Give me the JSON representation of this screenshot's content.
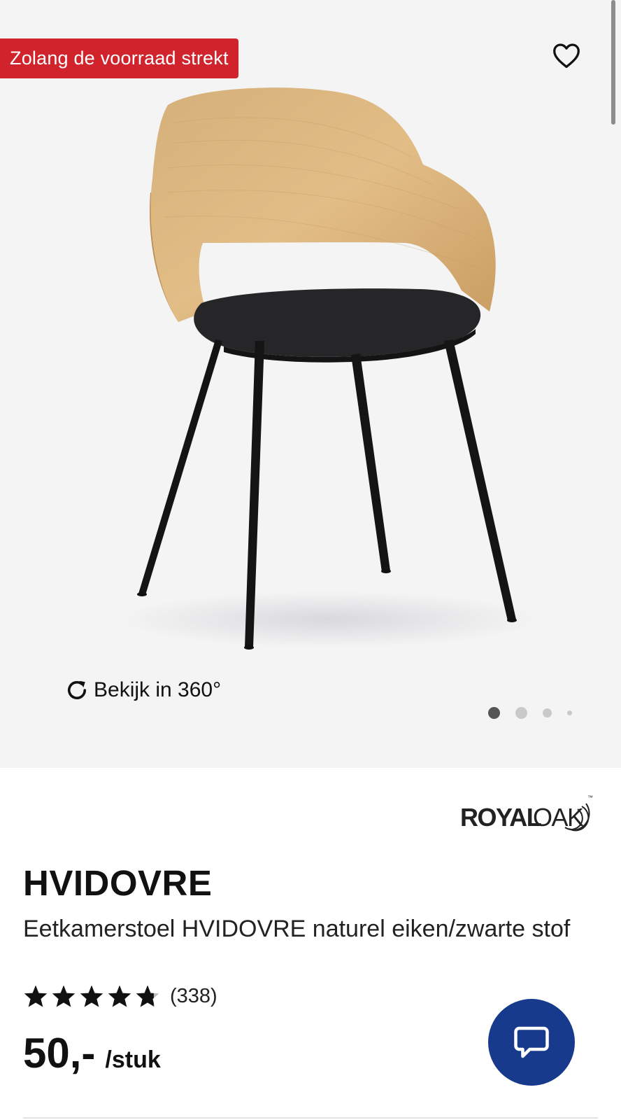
{
  "gallery": {
    "promo_badge": "Zolang de voorraad strekt",
    "view_360_label": "Bekijk in 360°",
    "dots_count": 4,
    "active_dot": 1,
    "favorite_icon": "heart-outline-icon"
  },
  "brand": {
    "logo_text_bold": "ROYAL",
    "logo_text_light": "OAK",
    "logo_tm": "™"
  },
  "product": {
    "title": "HVIDOVRE",
    "subtitle": "Eetkamerstoel HVIDOVRE naturel eiken/zwarte stof",
    "rating_value": 4.8,
    "rating_max": 5,
    "rating_count": "(338)",
    "price": "50,-",
    "price_unit": "/stuk"
  },
  "colors": {
    "promo_red": "#d0232c",
    "chat_blue": "#173a8c",
    "gallery_bg": "#f4f4f5"
  },
  "chat": {
    "icon": "speech-bubble-icon"
  }
}
